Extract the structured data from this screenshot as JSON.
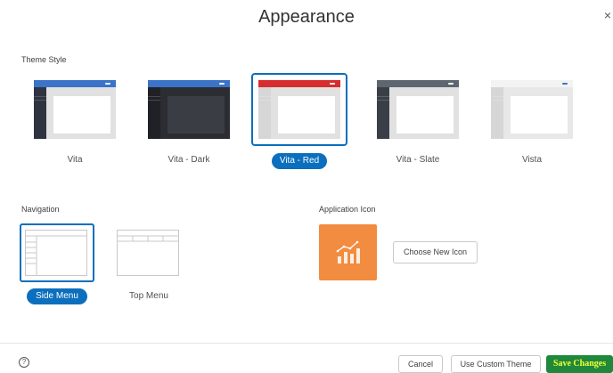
{
  "dialog": {
    "title": "Appearance",
    "close_glyph": "×"
  },
  "theme_style": {
    "label": "Theme Style",
    "options": [
      {
        "label": "Vita",
        "selected": false,
        "header_color": "#3b73c8",
        "nav_color": "#2f3340",
        "bg_color": "#e1e1e1",
        "content_color": "#ffffff",
        "button_color": "#3b73c8"
      },
      {
        "label": "Vita - Dark",
        "selected": false,
        "header_color": "#3b73c8",
        "nav_color": "#1f2126",
        "bg_color": "#2b2d33",
        "content_color": "#3b3d44",
        "button_color": "#3b73c8"
      },
      {
        "label": "Vita - Red",
        "selected": true,
        "header_color": "#d62e2e",
        "nav_color": "#d6d6d6",
        "bg_color": "#e1e1e1",
        "content_color": "#ffffff",
        "button_color": "#d62e2e"
      },
      {
        "label": "Vita - Slate",
        "selected": false,
        "header_color": "#5e6670",
        "nav_color": "#3a3f47",
        "bg_color": "#e1e1e1",
        "content_color": "#ffffff",
        "button_color": "#5e6670"
      },
      {
        "label": "Vista",
        "selected": false,
        "header_color": "#f3f3f3",
        "nav_color": "#d6d6d6",
        "bg_color": "#e8e8e8",
        "content_color": "#ffffff",
        "button_color": "#3b73c8"
      }
    ]
  },
  "navigation": {
    "label": "Navigation",
    "options": [
      {
        "label": "Side Menu",
        "selected": true
      },
      {
        "label": "Top Menu",
        "selected": false
      }
    ]
  },
  "application_icon": {
    "label": "Application Icon",
    "icon": "chart-trend-icon",
    "icon_color": "#f28c40",
    "choose_button": "Choose New Icon"
  },
  "footer": {
    "help_glyph": "?",
    "cancel": "Cancel",
    "use_custom_theme": "Use Custom Theme",
    "save_changes": "Save Changes"
  }
}
